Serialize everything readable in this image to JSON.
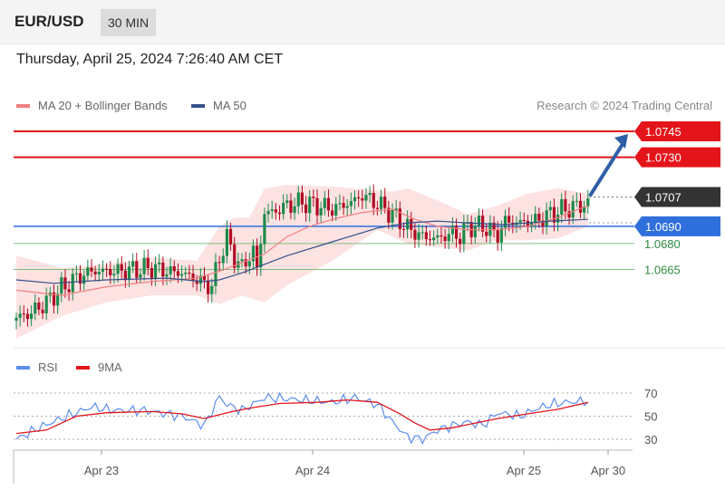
{
  "header": {
    "symbol": "EUR/USD",
    "timeframe": "30 MIN"
  },
  "timestamp": "Thursday, April 25, 2024 7:26:40 AM CET",
  "legend": {
    "ma": "MA 20 + Bollinger Bands",
    "ma50": "MA 50",
    "rsi": "RSI",
    "rsi_ma": "9MA"
  },
  "credit": "Research © 2024 Trading Central",
  "colors": {
    "resistance": "#e3151a",
    "support": "#2f6fdc",
    "support_green": "#7fbf7f",
    "ma20": "#f08080",
    "ma50": "#34508a",
    "band": "#fde2e2",
    "up": "#1d8a4a",
    "down": "#b00b23",
    "rsi": "#5b8def",
    "rsi_ma": "#e3151a",
    "last_price": "#333333"
  },
  "chart_data": [
    {
      "type": "candlestick",
      "symbol": "EUR/USD",
      "timeframe": "30 MIN",
      "ylim": [
        1.062,
        1.076
      ],
      "x_ticks": [
        "Apr 23",
        "Apr 24",
        "Apr 25",
        "Apr 30"
      ],
      "levels": [
        {
          "value": "1.0745",
          "kind": "resistance"
        },
        {
          "value": "1.0730",
          "kind": "resistance"
        },
        {
          "value": "1.0707",
          "kind": "last"
        },
        {
          "value": "1.0690",
          "kind": "support"
        },
        {
          "value": "1.0680",
          "kind": "support2"
        },
        {
          "value": "1.0665",
          "kind": "support2"
        }
      ],
      "target_arrow": {
        "from": 1.0707,
        "to": 1.0745
      },
      "close_path": [
        [
          0,
          1.0637
        ],
        [
          4,
          1.064
        ],
        [
          8,
          1.0646
        ],
        [
          12,
          1.0654
        ],
        [
          16,
          1.066
        ],
        [
          20,
          1.0664
        ],
        [
          24,
          1.0664
        ],
        [
          28,
          1.0664
        ],
        [
          32,
          1.0665
        ],
        [
          36,
          1.0666
        ],
        [
          40,
          1.0664
        ],
        [
          44,
          1.0663
        ],
        [
          48,
          1.0659
        ],
        [
          52,
          1.0655
        ],
        [
          54,
          1.0672
        ],
        [
          56,
          1.0683
        ],
        [
          58,
          1.0672
        ],
        [
          60,
          1.0666
        ],
        [
          63,
          1.0676
        ],
        [
          64,
          1.0665
        ],
        [
          66,
          1.0698
        ],
        [
          68,
          1.0698
        ],
        [
          72,
          1.0702
        ],
        [
          76,
          1.0704
        ],
        [
          80,
          1.0702
        ],
        [
          84,
          1.07
        ],
        [
          88,
          1.0703
        ],
        [
          90,
          1.0705
        ],
        [
          92,
          1.0708
        ],
        [
          96,
          1.0703
        ],
        [
          100,
          1.0697
        ],
        [
          104,
          1.0689
        ],
        [
          108,
          1.0684
        ],
        [
          112,
          1.0683
        ],
        [
          116,
          1.0686
        ],
        [
          118,
          1.0684
        ],
        [
          120,
          1.069
        ],
        [
          124,
          1.069
        ],
        [
          128,
          1.0685
        ],
        [
          130,
          1.0693
        ],
        [
          134,
          1.0692
        ],
        [
          138,
          1.0693
        ],
        [
          142,
          1.0697
        ],
        [
          146,
          1.07
        ],
        [
          150,
          1.0702
        ],
        [
          152,
          1.0703
        ]
      ],
      "ma20": [
        [
          0,
          1.0653
        ],
        [
          12,
          1.065
        ],
        [
          24,
          1.0655
        ],
        [
          36,
          1.0658
        ],
        [
          48,
          1.066
        ],
        [
          54,
          1.0664
        ],
        [
          60,
          1.0669
        ],
        [
          66,
          1.0674
        ],
        [
          72,
          1.0684
        ],
        [
          78,
          1.069
        ],
        [
          84,
          1.0694
        ],
        [
          92,
          1.0698
        ],
        [
          100,
          1.07
        ],
        [
          106,
          1.0694
        ],
        [
          112,
          1.069
        ],
        [
          120,
          1.0688
        ],
        [
          128,
          1.0688
        ],
        [
          136,
          1.069
        ],
        [
          144,
          1.0695
        ],
        [
          152,
          1.0702
        ]
      ],
      "ma50": [
        [
          0,
          1.0659
        ],
        [
          10,
          1.0657
        ],
        [
          24,
          1.0659
        ],
        [
          40,
          1.066
        ],
        [
          50,
          1.0658
        ],
        [
          54,
          1.0659
        ],
        [
          60,
          1.0663
        ],
        [
          66,
          1.0668
        ],
        [
          72,
          1.0673
        ],
        [
          84,
          1.0681
        ],
        [
          96,
          1.0689
        ],
        [
          104,
          1.0692
        ],
        [
          112,
          1.0693
        ],
        [
          120,
          1.0692
        ],
        [
          130,
          1.0691
        ],
        [
          142,
          1.0693
        ],
        [
          152,
          1.0694
        ]
      ],
      "band_upper": [
        [
          0,
          1.0673
        ],
        [
          12,
          1.0666
        ],
        [
          24,
          1.0668
        ],
        [
          36,
          1.0672
        ],
        [
          48,
          1.067
        ],
        [
          54,
          1.069
        ],
        [
          58,
          1.0695
        ],
        [
          62,
          1.0695
        ],
        [
          66,
          1.0712
        ],
        [
          72,
          1.0714
        ],
        [
          84,
          1.0713
        ],
        [
          100,
          1.071
        ],
        [
          104,
          1.0712
        ],
        [
          112,
          1.0705
        ],
        [
          120,
          1.0697
        ],
        [
          128,
          1.0702
        ],
        [
          136,
          1.0709
        ],
        [
          144,
          1.0712
        ],
        [
          152,
          1.0709
        ]
      ],
      "band_lower": [
        [
          0,
          1.0625
        ],
        [
          12,
          1.0638
        ],
        [
          24,
          1.0646
        ],
        [
          36,
          1.065
        ],
        [
          48,
          1.065
        ],
        [
          54,
          1.0645
        ],
        [
          60,
          1.065
        ],
        [
          66,
          1.0646
        ],
        [
          72,
          1.0656
        ],
        [
          84,
          1.067
        ],
        [
          96,
          1.0688
        ],
        [
          104,
          1.068
        ],
        [
          112,
          1.0678
        ],
        [
          120,
          1.0676
        ],
        [
          128,
          1.0682
        ],
        [
          136,
          1.0682
        ],
        [
          144,
          1.0683
        ],
        [
          152,
          1.069
        ]
      ]
    },
    {
      "type": "line",
      "name": "RSI",
      "ylim": [
        20,
        80
      ],
      "y_ticks": [
        "70",
        "50",
        "30"
      ],
      "series": [
        {
          "name": "RSI",
          "values": [
            [
              0,
              30
            ],
            [
              6,
              40
            ],
            [
              12,
              48
            ],
            [
              20,
              58
            ],
            [
              26,
              55
            ],
            [
              34,
              55
            ],
            [
              44,
              50
            ],
            [
              50,
              42
            ],
            [
              54,
              67
            ],
            [
              56,
              60
            ],
            [
              60,
              55
            ],
            [
              66,
              66
            ],
            [
              72,
              65
            ],
            [
              80,
              63
            ],
            [
              84,
              62
            ],
            [
              90,
              66
            ],
            [
              96,
              60
            ],
            [
              100,
              45
            ],
            [
              104,
              32
            ],
            [
              108,
              30
            ],
            [
              112,
              38
            ],
            [
              116,
              42
            ],
            [
              120,
              45
            ],
            [
              124,
              42
            ],
            [
              128,
              53
            ],
            [
              134,
              50
            ],
            [
              138,
              56
            ],
            [
              142,
              60
            ],
            [
              146,
              62
            ],
            [
              152,
              63
            ]
          ]
        },
        {
          "name": "9MA",
          "values": [
            [
              0,
              35
            ],
            [
              8,
              38
            ],
            [
              16,
              50
            ],
            [
              24,
              53
            ],
            [
              36,
              54
            ],
            [
              44,
              52
            ],
            [
              50,
              48
            ],
            [
              56,
              53
            ],
            [
              62,
              57
            ],
            [
              70,
              61
            ],
            [
              80,
              62
            ],
            [
              88,
              64
            ],
            [
              96,
              62
            ],
            [
              102,
              52
            ],
            [
              106,
              44
            ],
            [
              110,
              38
            ],
            [
              116,
              40
            ],
            [
              122,
              44
            ],
            [
              128,
              48
            ],
            [
              136,
              52
            ],
            [
              144,
              56
            ],
            [
              152,
              62
            ]
          ]
        }
      ]
    }
  ]
}
